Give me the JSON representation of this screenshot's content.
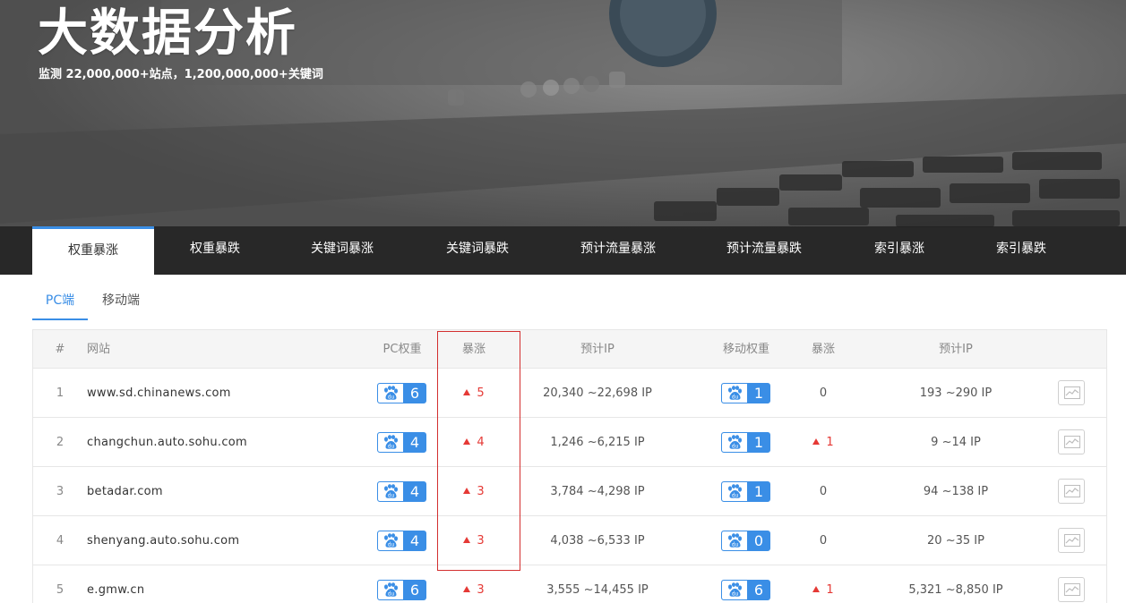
{
  "hero": {
    "title": "大数据分析",
    "subtitle": "监测 22,000,000+站点，1,200,000,000+关键词"
  },
  "main_tabs": [
    {
      "label": "权重暴涨",
      "active": true
    },
    {
      "label": "权重暴跌",
      "active": false
    },
    {
      "label": "关键词暴涨",
      "active": false
    },
    {
      "label": "关键词暴跌",
      "active": false
    },
    {
      "label": "预计流量暴涨",
      "active": false
    },
    {
      "label": "预计流量暴跌",
      "active": false
    },
    {
      "label": "索引暴涨",
      "active": false
    },
    {
      "label": "索引暴跌",
      "active": false
    }
  ],
  "sub_tabs": [
    {
      "label": "PC端",
      "active": true
    },
    {
      "label": "移动端",
      "active": false
    }
  ],
  "table": {
    "headers": {
      "num": "#",
      "site": "网站",
      "pc_weight": "PC权重",
      "pc_change": "暴涨",
      "pc_ip": "预计IP",
      "mobile_weight": "移动权重",
      "mobile_change": "暴涨",
      "mobile_ip": "预计IP"
    },
    "rows": [
      {
        "num": "1",
        "site": "www.sd.chinanews.com",
        "pc_weight": "6",
        "pc_change": "5",
        "pc_ip": "20,340 ~22,698 IP",
        "mobile_weight": "1",
        "mobile_change": "0",
        "mobile_change_up": false,
        "mobile_ip": "193 ~290 IP"
      },
      {
        "num": "2",
        "site": "changchun.auto.sohu.com",
        "pc_weight": "4",
        "pc_change": "4",
        "pc_ip": "1,246 ~6,215 IP",
        "mobile_weight": "1",
        "mobile_change": "1",
        "mobile_change_up": true,
        "mobile_ip": "9 ~14 IP"
      },
      {
        "num": "3",
        "site": "betadar.com",
        "pc_weight": "4",
        "pc_change": "3",
        "pc_ip": "3,784 ~4,298 IP",
        "mobile_weight": "1",
        "mobile_change": "0",
        "mobile_change_up": false,
        "mobile_ip": "94 ~138 IP"
      },
      {
        "num": "4",
        "site": "shenyang.auto.sohu.com",
        "pc_weight": "4",
        "pc_change": "3",
        "pc_ip": "4,038 ~6,533 IP",
        "mobile_weight": "0",
        "mobile_change": "0",
        "mobile_change_up": false,
        "mobile_ip": "20 ~35 IP"
      },
      {
        "num": "5",
        "site": "e.gmw.cn",
        "pc_weight": "6",
        "pc_change": "3",
        "pc_ip": "3,555 ~14,455 IP",
        "mobile_weight": "6",
        "mobile_change": "1",
        "mobile_change_up": true,
        "mobile_ip": "5,321 ~8,850 IP"
      }
    ]
  },
  "icons": {
    "weight_badge": "baidu-paw-icon",
    "change_up": "triangle-up-icon",
    "trend": "trend-chart-icon"
  },
  "colors": {
    "accent": "#3a8ee6",
    "up": "#e53935",
    "highlight": "#d32f2f"
  }
}
